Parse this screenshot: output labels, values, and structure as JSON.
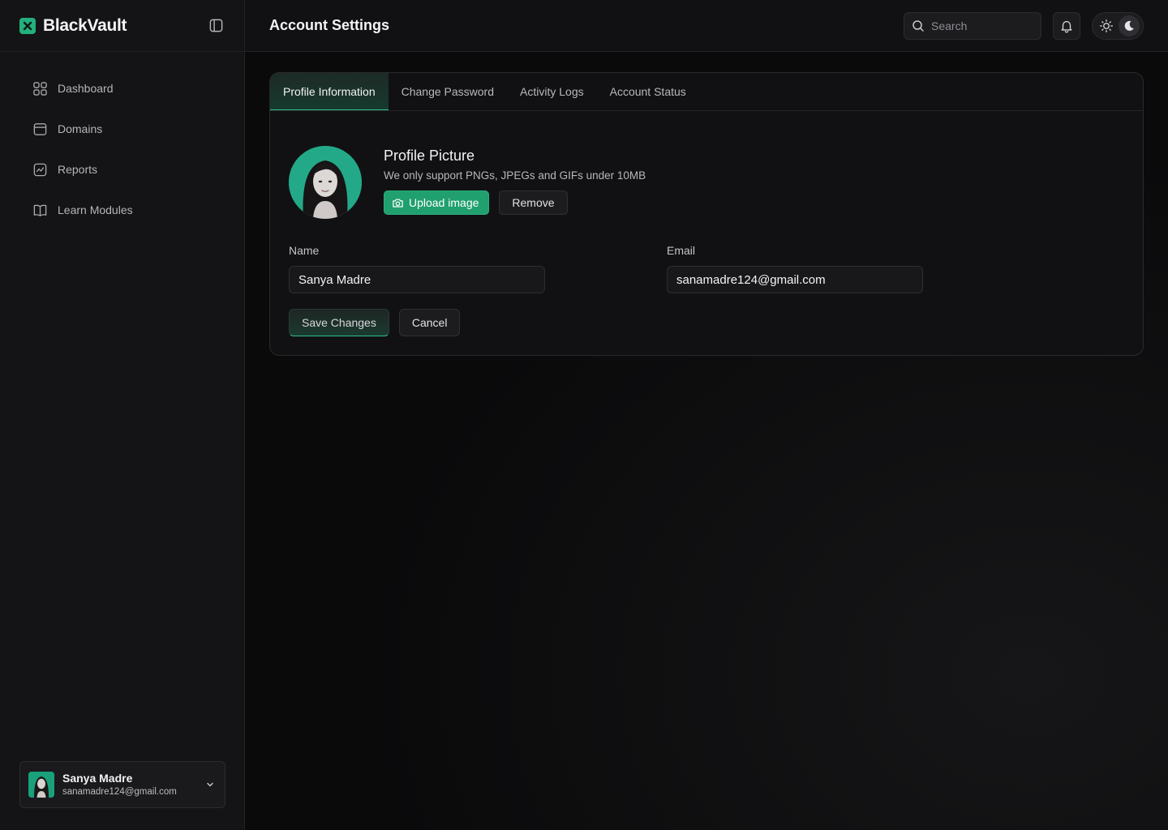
{
  "brand": {
    "name": "BlackVault",
    "logo_icon": "x-mark-icon",
    "accent_color": "#22b07d"
  },
  "sidebar": {
    "items": [
      {
        "label": "Dashboard",
        "icon": "grid-icon"
      },
      {
        "label": "Domains",
        "icon": "browser-window-icon"
      },
      {
        "label": "Reports",
        "icon": "chart-line-icon"
      },
      {
        "label": "Learn Modules",
        "icon": "book-open-icon"
      }
    ],
    "user": {
      "name": "Sanya Madre",
      "email": "sanamadre124@gmail.com"
    }
  },
  "header": {
    "title": "Account Settings",
    "search": {
      "placeholder": "Search",
      "value": ""
    }
  },
  "tabs": [
    {
      "label": "Profile Information",
      "active": true
    },
    {
      "label": "Change Password",
      "active": false
    },
    {
      "label": "Activity Logs",
      "active": false
    },
    {
      "label": "Account Status",
      "active": false
    }
  ],
  "profile": {
    "picture_title": "Profile Picture",
    "picture_hint": "We only support PNGs, JPEGs and GIFs under 10MB",
    "upload_label": "Upload image",
    "remove_label": "Remove"
  },
  "form": {
    "name_label": "Name",
    "name_value": "Sanya Madre",
    "email_label": "Email",
    "email_value": "sanamadre124@gmail.com",
    "save_label": "Save Changes",
    "cancel_label": "Cancel"
  }
}
